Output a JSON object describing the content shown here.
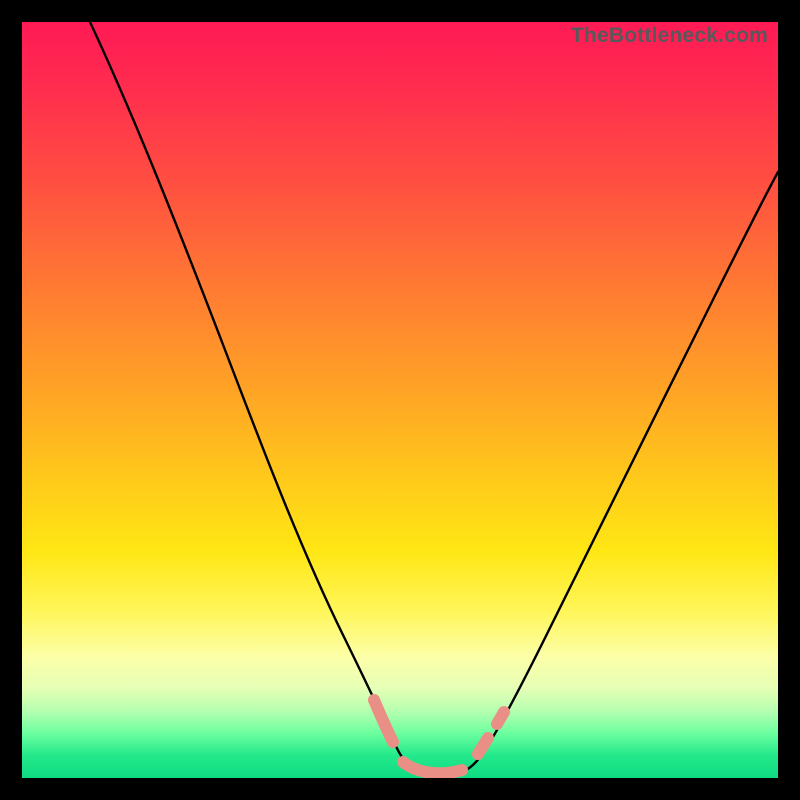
{
  "watermark": "TheBottleneck.com",
  "chart_data": {
    "type": "line",
    "title": "",
    "xlabel": "",
    "ylabel": "",
    "xlim": [
      0,
      100
    ],
    "ylim": [
      0,
      100
    ],
    "grid": false,
    "legend": false,
    "series": [
      {
        "name": "bottleneck-curve",
        "color": "#000000",
        "x": [
          10,
          14,
          18,
          22,
          26,
          30,
          34,
          38,
          42,
          45,
          47,
          49,
          51,
          53,
          55,
          58,
          61,
          64,
          68,
          72,
          76,
          80,
          84,
          88,
          92,
          96,
          100
        ],
        "y": [
          100,
          90,
          80,
          70,
          60,
          50,
          41,
          32,
          23,
          16,
          11,
          7,
          4,
          2,
          1,
          1,
          2,
          4,
          8,
          14,
          21,
          29,
          37,
          45,
          53,
          61,
          69
        ]
      }
    ],
    "markers": [
      {
        "name": "salmon-segment-left",
        "x_range": [
          46,
          50
        ],
        "y": 6,
        "color": "#e98f86"
      },
      {
        "name": "salmon-segment-mid",
        "x_range": [
          50,
          58
        ],
        "y": 1.5,
        "color": "#e98f86"
      },
      {
        "name": "salmon-dot-right",
        "x": 60.5,
        "y": 4.5,
        "color": "#e98f86"
      },
      {
        "name": "salmon-dot-right-2",
        "x": 62.5,
        "y": 8,
        "color": "#e98f86"
      }
    ],
    "background_gradient_stops": [
      {
        "pos": 0,
        "color": "#ff1a55"
      },
      {
        "pos": 22,
        "color": "#ff5140"
      },
      {
        "pos": 48,
        "color": "#ffa126"
      },
      {
        "pos": 70,
        "color": "#ffe714"
      },
      {
        "pos": 88,
        "color": "#e7ffb6"
      },
      {
        "pos": 100,
        "color": "#0fdc82"
      }
    ]
  }
}
